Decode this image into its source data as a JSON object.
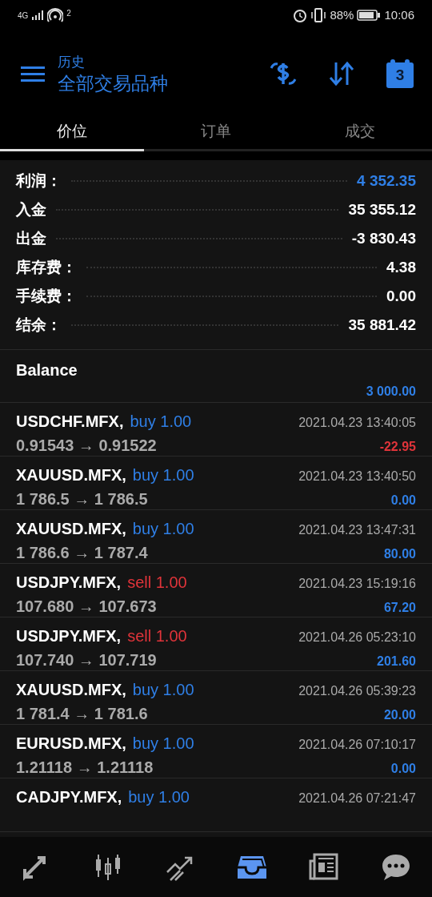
{
  "status_bar": {
    "network": "4G",
    "sim": "2",
    "battery": "88%",
    "time": "10:06"
  },
  "header": {
    "subtitle": "历史",
    "title": "全部交易品种",
    "calendar_day": "3"
  },
  "tabs": [
    {
      "label": "价位",
      "selected": true
    },
    {
      "label": "订单",
      "selected": false
    },
    {
      "label": "成交",
      "selected": false
    }
  ],
  "summary": [
    {
      "label": "利润：",
      "value": "4 352.35",
      "highlight": true
    },
    {
      "label": "入金",
      "value": "35 355.12",
      "highlight": false
    },
    {
      "label": "出金",
      "value": "-3 830.43",
      "highlight": false
    },
    {
      "label": "库存费：",
      "value": "4.38",
      "highlight": false
    },
    {
      "label": "手续费：",
      "value": "0.00",
      "highlight": false
    },
    {
      "label": "结余：",
      "value": "35 881.42",
      "highlight": false
    }
  ],
  "balance": {
    "label": "Balance",
    "amount": "3 000.00"
  },
  "deals": [
    {
      "symbol": "USDCHF.MFX,",
      "kind": "buy",
      "volume": "buy 1.00",
      "time": "2021.04.23 13:40:05",
      "prices": "0.91543 → 0.91522",
      "profit": "-22.95"
    },
    {
      "symbol": "XAUUSD.MFX,",
      "kind": "buy",
      "volume": "buy 1.00",
      "time": "2021.04.23 13:40:50",
      "prices": "1 786.5 → 1 786.5",
      "profit": "0.00"
    },
    {
      "symbol": "XAUUSD.MFX,",
      "kind": "buy",
      "volume": "buy 1.00",
      "time": "2021.04.23 13:47:31",
      "prices": "1 786.6 → 1 787.4",
      "profit": "80.00"
    },
    {
      "symbol": "USDJPY.MFX,",
      "kind": "sell",
      "volume": "sell 1.00",
      "time": "2021.04.23 15:19:16",
      "prices": "107.680 → 107.673",
      "profit": "67.20"
    },
    {
      "symbol": "USDJPY.MFX,",
      "kind": "sell",
      "volume": "sell 1.00",
      "time": "2021.04.26 05:23:10",
      "prices": "107.740 → 107.719",
      "profit": "201.60"
    },
    {
      "symbol": "XAUUSD.MFX,",
      "kind": "buy",
      "volume": "buy 1.00",
      "time": "2021.04.26 05:39:23",
      "prices": "1 781.4 → 1 781.6",
      "profit": "20.00"
    },
    {
      "symbol": "EURUSD.MFX,",
      "kind": "buy",
      "volume": "buy 1.00",
      "time": "2021.04.26 07:10:17",
      "prices": "1.21118 → 1.21118",
      "profit": "0.00"
    },
    {
      "symbol": "CADJPY.MFX,",
      "kind": "buy",
      "volume": "buy 1.00",
      "time": "2021.04.26 07:21:47"
    }
  ],
  "nav": [
    {
      "kind": "quotes",
      "selected": false
    },
    {
      "kind": "chart",
      "selected": false
    },
    {
      "kind": "trade",
      "selected": false
    },
    {
      "kind": "history",
      "selected": true
    },
    {
      "kind": "news",
      "selected": false
    },
    {
      "kind": "chat",
      "selected": false
    }
  ]
}
